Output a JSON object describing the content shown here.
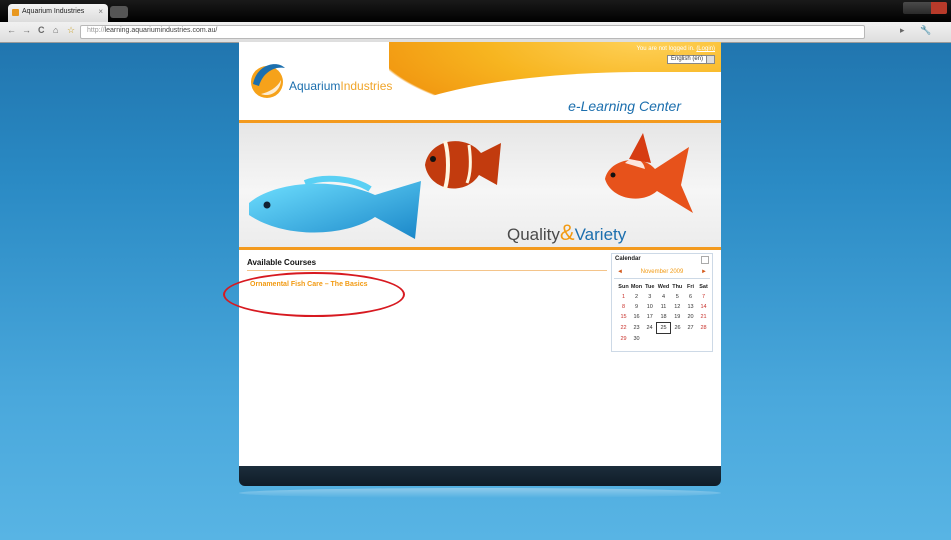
{
  "browser": {
    "tab_title": "Aquarium Industries",
    "tab_close": "×",
    "url_protocol": "http://",
    "url_host": "learning.aquariumindustries.com.au/",
    "nav_back": "←",
    "nav_forward": "→",
    "nav_reload": "C",
    "nav_home": "⌂",
    "bookmark_star": "☆",
    "menu_page": "▸",
    "menu_tools": "🔧"
  },
  "header": {
    "brand_part1": "Aquarium",
    "brand_part2": "Industries",
    "subtitle": "e-Learning Center",
    "login_text": "You are not logged in.",
    "login_link": "(Login)",
    "language": "English (en)"
  },
  "banner": {
    "tagline_part1": "Quality",
    "tagline_amp": "&",
    "tagline_part2": "Variety"
  },
  "courses": {
    "title": "Available Courses",
    "items": [
      {
        "label": "Ornamental Fish Care – The Basics"
      }
    ]
  },
  "calendar": {
    "title": "Calendar",
    "month": "November 2009",
    "prev": "◄",
    "next": "►",
    "weekdays": [
      "Sun",
      "Mon",
      "Tue",
      "Wed",
      "Thu",
      "Fri",
      "Sat"
    ],
    "weeks": [
      [
        "1",
        "2",
        "3",
        "4",
        "5",
        "6",
        "7"
      ],
      [
        "8",
        "9",
        "10",
        "11",
        "12",
        "13",
        "14"
      ],
      [
        "15",
        "16",
        "17",
        "18",
        "19",
        "20",
        "21"
      ],
      [
        "22",
        "23",
        "24",
        "25",
        "26",
        "27",
        "28"
      ],
      [
        "29",
        "30",
        "",
        "",
        "",
        "",
        ""
      ]
    ],
    "today": "25"
  },
  "colors": {
    "accent_orange": "#f29a12",
    "brand_blue": "#1c6fae",
    "highlight_red": "#d71920"
  }
}
